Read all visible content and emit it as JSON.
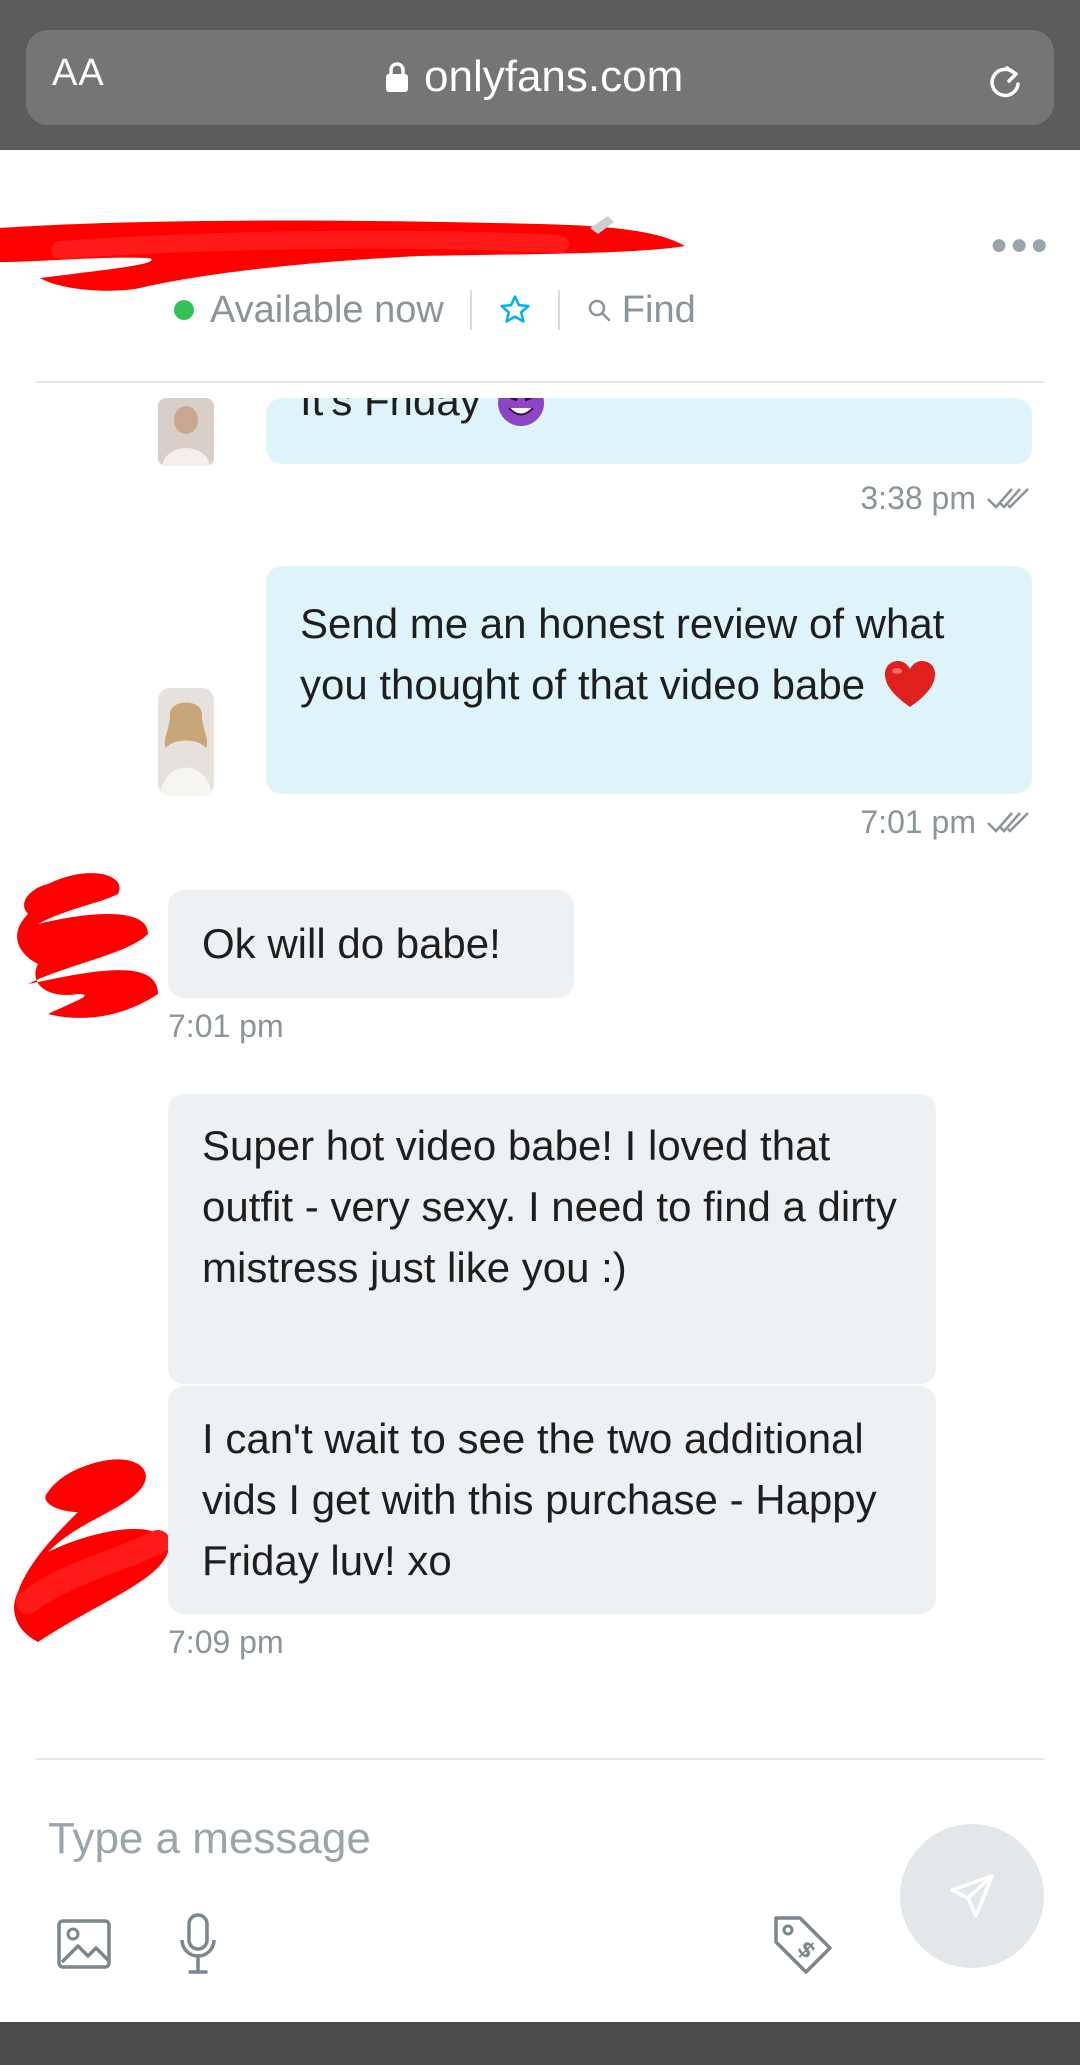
{
  "browser": {
    "text_size_label": "AA",
    "domain": "onlyfans.com",
    "icons": [
      "lock-icon",
      "reload-icon"
    ]
  },
  "chat_header": {
    "status": "Available now",
    "find_label": "Find",
    "icons": [
      "more-icon",
      "star-icon",
      "search-icon",
      "edit-icon"
    ]
  },
  "messages": [
    {
      "id": "m1",
      "direction": "outgoing",
      "text": "It's Friday",
      "emoji": "smiling-devil-emoji",
      "time": "3:38 pm",
      "read": true
    },
    {
      "id": "m2",
      "direction": "outgoing",
      "text": "Send me an honest review of what you thought of that video babe",
      "emoji": "red-heart-emoji",
      "time": "7:01 pm",
      "read": true
    },
    {
      "id": "m3",
      "direction": "incoming",
      "text": "Ok will do babe!",
      "time": "7:01 pm"
    },
    {
      "id": "m4",
      "direction": "incoming",
      "text": "Super hot video babe! I loved that outfit - very sexy. I need to find a dirty mistress just like you :)",
      "time": ""
    },
    {
      "id": "m5",
      "direction": "incoming",
      "text": "I can't wait to see the two additional vids I get with this purchase - Happy Friday luv! xo",
      "time": "7:09 pm"
    }
  ],
  "composer": {
    "placeholder": "Type a message",
    "icons": [
      "image-icon",
      "microphone-icon",
      "price-tag-icon",
      "send-icon"
    ]
  },
  "colors": {
    "browser_bar": "#5c5c5c",
    "outgoing_bubble": "#dff3fb",
    "incoming_bubble": "#eef1f3",
    "online_dot": "#33c15a",
    "redaction": "#ff0000",
    "accent": "#00aff0"
  }
}
